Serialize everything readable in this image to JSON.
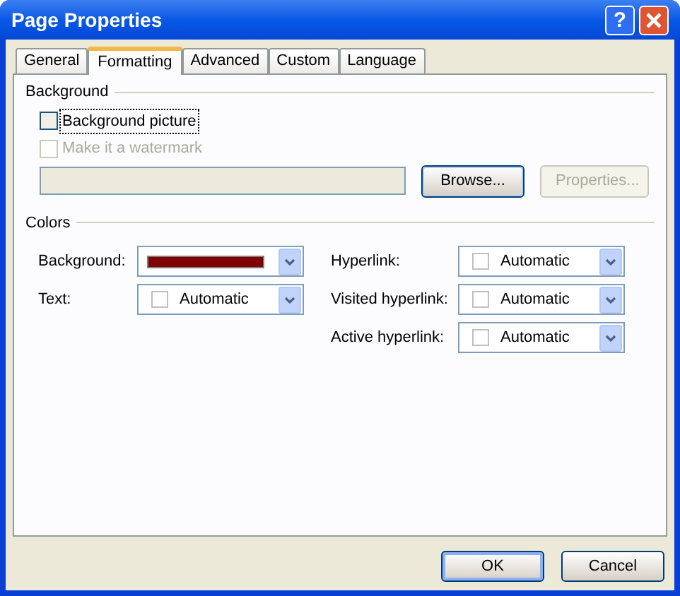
{
  "window": {
    "title": "Page Properties"
  },
  "title_buttons": [
    {
      "kind": "help",
      "label": "?"
    },
    {
      "kind": "close"
    }
  ],
  "tabs": [
    {
      "label": "General",
      "selected": false
    },
    {
      "label": "Formatting",
      "selected": true
    },
    {
      "label": "Advanced",
      "selected": false
    },
    {
      "label": "Custom",
      "selected": false
    },
    {
      "label": "Language",
      "selected": false
    }
  ],
  "background": {
    "legend": "Background",
    "checkboxes": [
      {
        "label": "Background picture",
        "checked": false,
        "disabled": false,
        "focused": true
      },
      {
        "label": "Make it a watermark",
        "checked": false,
        "disabled": true,
        "focused": false
      }
    ],
    "path_field": {
      "disabled": true
    },
    "buttons": [
      {
        "label": "Browse...",
        "disabled": false
      },
      {
        "label": "Properties...",
        "disabled": true
      }
    ]
  },
  "colors": {
    "legend": "Colors",
    "left": [
      {
        "label": "Background:",
        "kind": "swatch",
        "color": "#800000"
      },
      {
        "label": "Text:",
        "kind": "automatic",
        "value": "Automatic"
      }
    ],
    "right": [
      {
        "label": "Hyperlink:",
        "kind": "automatic",
        "value": "Automatic"
      },
      {
        "label": "Visited hyperlink:",
        "kind": "automatic",
        "value": "Automatic"
      },
      {
        "label": "Active hyperlink:",
        "kind": "automatic",
        "value": "Automatic"
      }
    ]
  },
  "buttons": [
    {
      "label": "OK",
      "default": true
    },
    {
      "label": "Cancel",
      "default": false
    }
  ]
}
